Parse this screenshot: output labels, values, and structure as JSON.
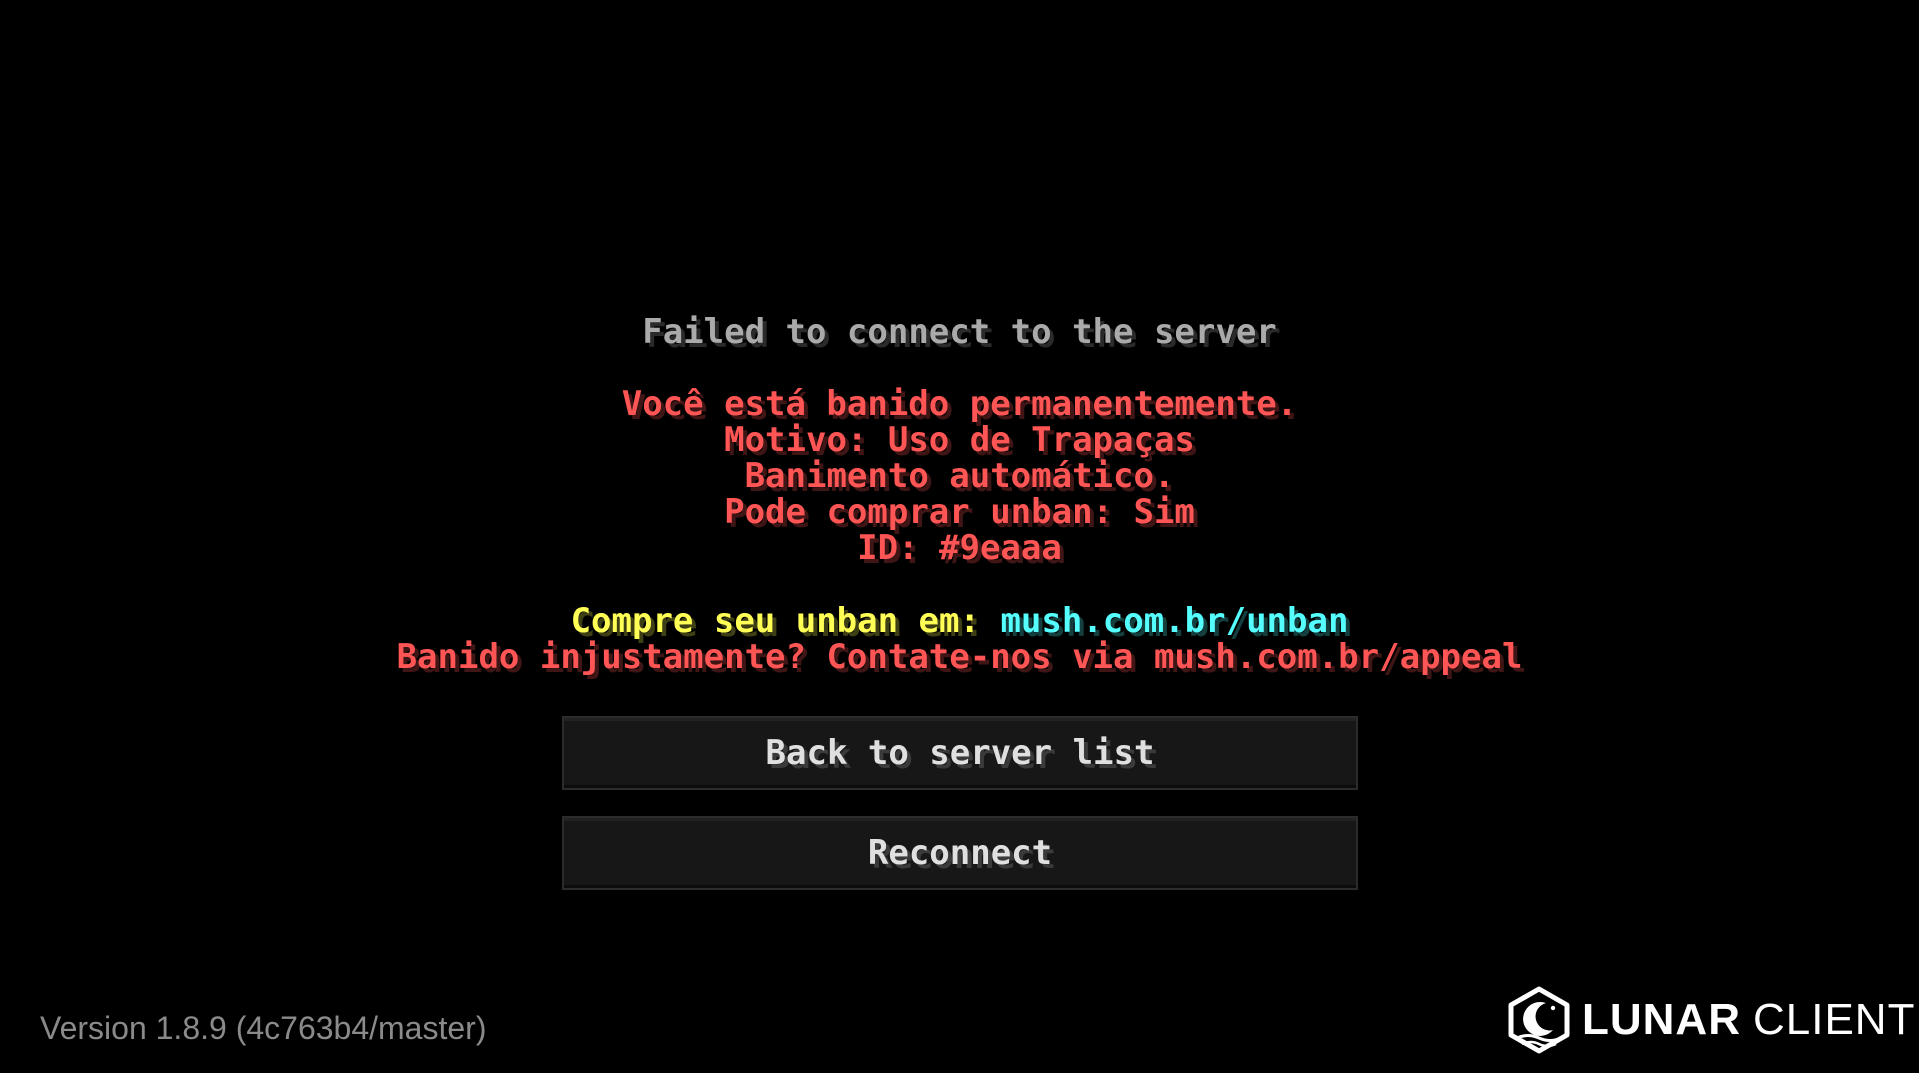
{
  "screen": {
    "title": "Failed to connect to the server",
    "reason_lines": [
      "Você está banido permanentemente.",
      "Motivo: Uso de Trapaças",
      "Banimento automático.",
      "Pode comprar unban: Sim",
      "ID: #9eaaa"
    ],
    "buy_prefix": "Compre seu unban em: ",
    "buy_link": "mush.com.br/unban",
    "appeal_line": "Banido injustamente? Contate-nos via mush.com.br/appeal"
  },
  "buttons": {
    "back_label": "Back to server list",
    "reconnect_label": "Reconnect"
  },
  "footer": {
    "version": "Version 1.8.9 (4c763b4/master)",
    "brand_primary": "LUNAR",
    "brand_secondary": "CLIENT",
    "brand_icon": "lunar-client-logo-icon"
  },
  "colors": {
    "background": "#000000",
    "title": "#aaaaaa",
    "reason": "#ff5555",
    "buy_prefix": "#ffff55",
    "buy_link": "#55ffff",
    "button_text": "#e0e0e0",
    "version_text": "#8a8a8a"
  }
}
